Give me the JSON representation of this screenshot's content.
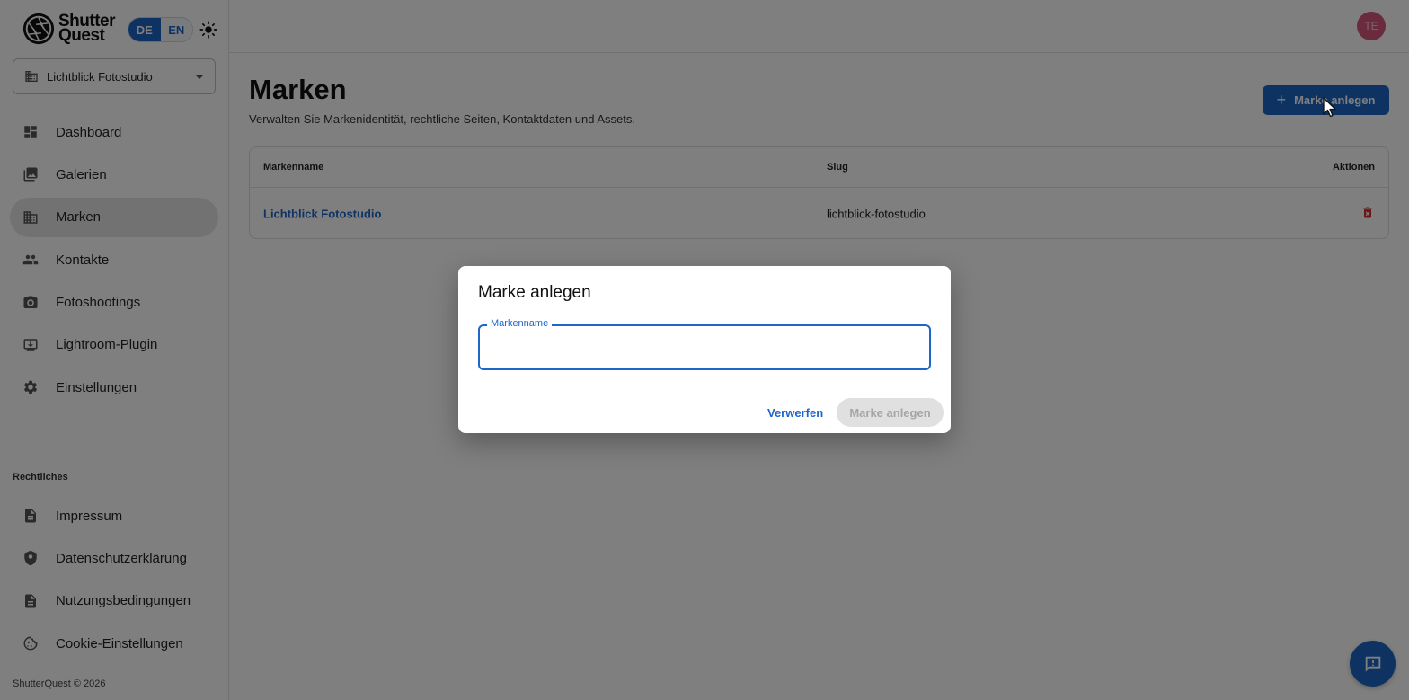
{
  "brand": {
    "line1": "Shutter",
    "line2": "Quest"
  },
  "language": {
    "options": [
      "DE",
      "EN"
    ],
    "active": "DE"
  },
  "studio_select": {
    "value": "Lichtblick Fotostudio"
  },
  "nav": {
    "items": [
      {
        "label": "Dashboard",
        "icon": "dashboard-icon"
      },
      {
        "label": "Galerien",
        "icon": "gallery-icon"
      },
      {
        "label": "Marken",
        "icon": "building-icon",
        "active": true
      },
      {
        "label": "Kontakte",
        "icon": "people-icon"
      },
      {
        "label": "Fotoshootings",
        "icon": "camera-icon"
      },
      {
        "label": "Lightroom-Plugin",
        "icon": "download-icon"
      },
      {
        "label": "Einstellungen",
        "icon": "gear-icon"
      }
    ]
  },
  "legal": {
    "heading": "Rechtliches",
    "items": [
      {
        "label": "Impressum",
        "icon": "document-icon"
      },
      {
        "label": "Datenschutzerklärung",
        "icon": "shield-icon"
      },
      {
        "label": "Nutzungsbedingungen",
        "icon": "document-icon"
      },
      {
        "label": "Cookie-Einstellungen",
        "icon": "cookie-icon"
      }
    ]
  },
  "footer": {
    "copyright": "ShutterQuest © 2026"
  },
  "header": {
    "avatar_initials": "TE"
  },
  "main": {
    "title": "Marken",
    "subtitle": "Verwalten Sie Markenidentität, rechtliche Seiten, Kontaktdaten und Assets.",
    "create_button": "Marke anlegen"
  },
  "table": {
    "columns": [
      "Markenname",
      "Slug",
      "Aktionen"
    ],
    "rows": [
      {
        "name": "Lichtblick Fotostudio",
        "slug": "lichtblick-fotostudio"
      }
    ]
  },
  "dialog": {
    "title": "Marke anlegen",
    "field_label": "Markenname",
    "field_value": "",
    "discard": "Verwerfen",
    "submit": "Marke anlegen"
  },
  "colors": {
    "primary": "#1d67c7",
    "avatar": "#d6577f",
    "danger": "#d32f2f",
    "active_nav": "#e4e4e4"
  }
}
